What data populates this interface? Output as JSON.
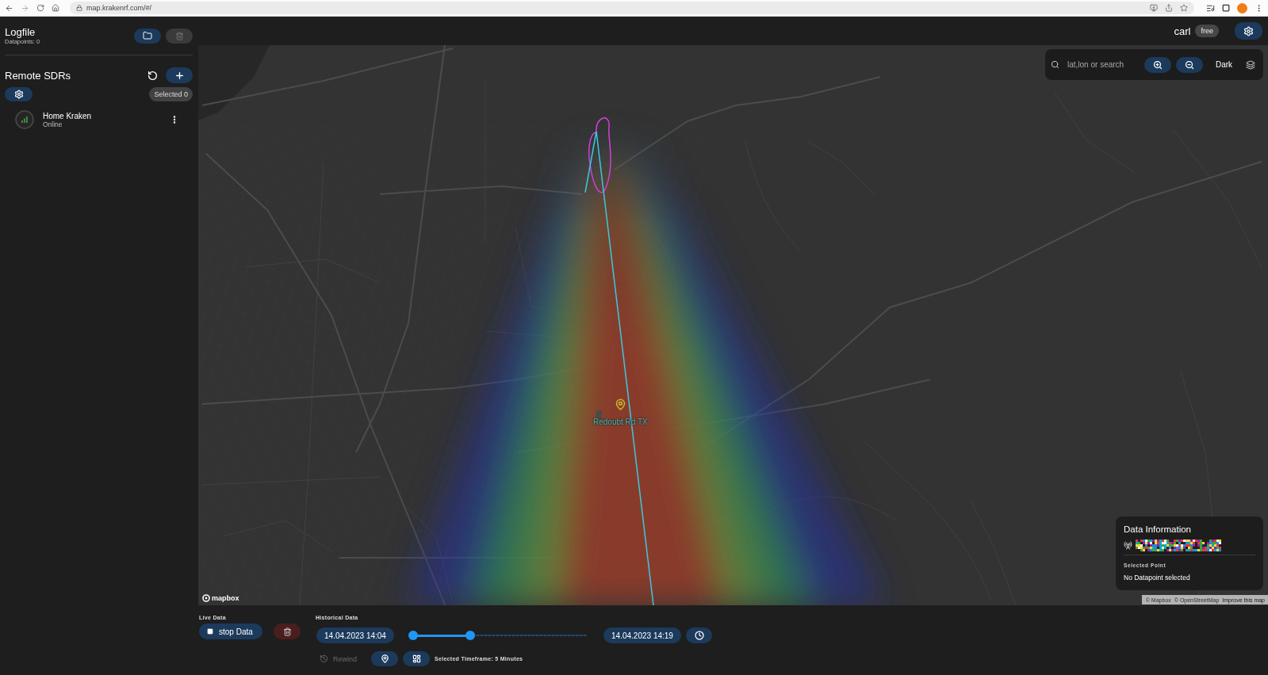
{
  "browser": {
    "url": "map.krakenrf.com/#/"
  },
  "sidebar": {
    "logfile": {
      "title": "Logfile",
      "datapoints": "Datapoints: 0",
      "delete_disabled": true
    },
    "remote_sdrs": {
      "title": "Remote SDRs",
      "selected_count": "Selected 0",
      "items": [
        {
          "name": "Home Kraken",
          "status": "Online",
          "online": true
        }
      ]
    }
  },
  "top_bar": {
    "user": "carl",
    "plan": "free"
  },
  "map": {
    "search": {
      "placeholder": "lat,lon or search"
    },
    "style": "Dark",
    "marker": {
      "label": "Redoubt Rd TX"
    },
    "logo": "mapbox",
    "attribution": [
      "© Mapbox",
      "© OpenStreetMap",
      "Improve this map"
    ],
    "data_information": {
      "title": "Data Information",
      "section": "Selected Point",
      "value": "No Datapoint selected"
    }
  },
  "bottom": {
    "live": {
      "label": "Live Data",
      "button": "stop Data"
    },
    "historical": {
      "label": "Historical Data",
      "start": "14.04.2023 14:04",
      "end": "14.04.2023 14:19",
      "range": {
        "level": 0.33
      },
      "rewind": {
        "label": "Rewind",
        "disabled": true
      },
      "timeframe": "Selected Timeframe: 5 Minutes"
    }
  }
}
